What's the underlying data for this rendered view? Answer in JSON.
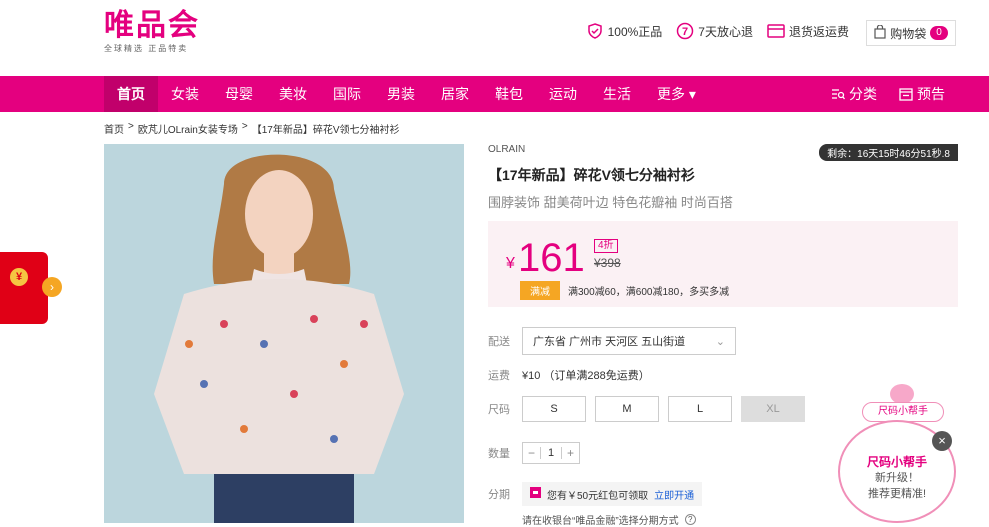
{
  "header": {
    "logo_main": "唯品会",
    "logo_sub": "全球精选 正品特卖",
    "promises": [
      {
        "icon": "shield-check-icon",
        "label": "100%正品"
      },
      {
        "icon": "seven-day-return-icon",
        "label": "7天放心退"
      },
      {
        "icon": "card-icon",
        "label": "退货返运费"
      }
    ],
    "cart_label": "购物袋",
    "cart_count": "0"
  },
  "nav": {
    "items": [
      "首页",
      "女装",
      "母婴",
      "美妆",
      "国际",
      "男装",
      "居家",
      "鞋包",
      "运动",
      "生活",
      "更多"
    ],
    "category_label": "分类",
    "preview_label": "预告",
    "accent": "#e4007f"
  },
  "breadcrumb": [
    "首页",
    "欧芃儿OLrain女装专场",
    "【17年新品】碎花V领七分袖衬衫"
  ],
  "product": {
    "brand": "OLRAIN",
    "countdown": "剩余：16天15时46分51秒.8",
    "title": "【17年新品】碎花V领七分袖衬衫",
    "subtitle": "围脖装饰 甜美荷叶边 特色花瓣袖 时尚百搭",
    "currency": "¥",
    "price": "161",
    "discount": "4折",
    "original_price": "¥398",
    "promo_tag": "满减",
    "promo_text": "满300减60，满600减180，多买多减"
  },
  "delivery": {
    "label": "配送",
    "address": "广东省 广州市 天河区 五山街道"
  },
  "shipping": {
    "label": "运费",
    "text": "¥10 （订单满288免运费）"
  },
  "sizes": {
    "label": "尺码",
    "options": [
      "S",
      "M",
      "L",
      "XL"
    ]
  },
  "quantity": {
    "label": "数量",
    "minus": "−",
    "value": "1",
    "plus": "+"
  },
  "installment": {
    "label": "分期",
    "text": "您有￥50元红包可领取",
    "link": "立即开通",
    "note": "请在收银台“唯品金融”选择分期方式"
  },
  "floating": {
    "redpacket_symbol": "¥",
    "helper_tag": "尺码小帮手",
    "helper_title": "尺码小帮手",
    "helper_line1": "新升级！",
    "helper_line2": "推荐更精准!"
  }
}
